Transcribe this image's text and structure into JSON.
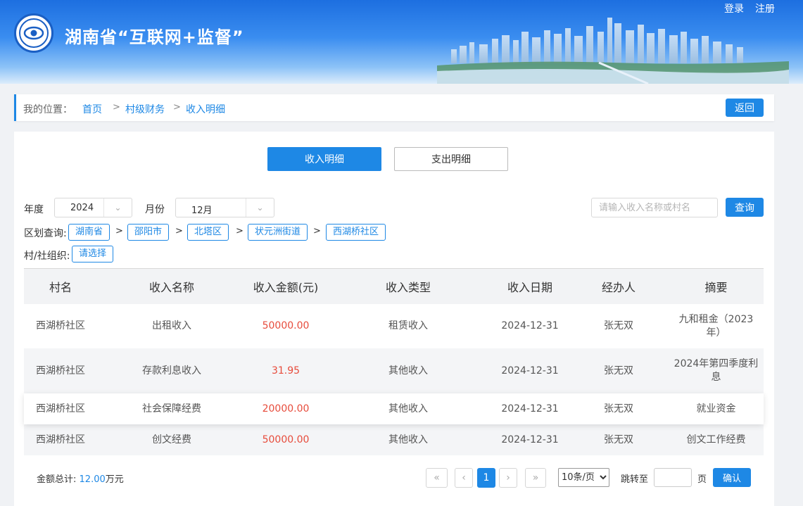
{
  "header": {
    "site_title": "湖南省“互联网+监督”",
    "login": "登录",
    "register": "注册"
  },
  "breadcrumb": {
    "prefix": "我的位置：",
    "items": [
      "首页",
      "村级财务",
      "收入明细"
    ],
    "separator": ">",
    "back": "返回"
  },
  "tabs": [
    "收入明细",
    "支出明细"
  ],
  "filters": {
    "year_label": "年度",
    "year_value": "2024",
    "month_label": "月份",
    "month_value": "12月",
    "search_placeholder": "请输入收入名称或村名",
    "query_button": "查询",
    "region_label": "区划查询:",
    "regions": [
      "湖南省",
      "邵阳市",
      "北塔区",
      "状元洲街道",
      "西湖桥社区"
    ],
    "region_separator": ">",
    "org_label": "村/社组织:",
    "org_value": "请选择"
  },
  "table": {
    "columns": [
      "村名",
      "收入名称",
      "收入金额(元)",
      "收入类型",
      "收入日期",
      "经办人",
      "摘要"
    ],
    "rows": [
      {
        "village": "西湖桥社区",
        "name": "出租收入",
        "amount": "50000.00",
        "type": "租赁收入",
        "date": "2024-12-31",
        "handler": "张无双",
        "summary": "九和租金（2023年）"
      },
      {
        "village": "西湖桥社区",
        "name": "存款利息收入",
        "amount": "31.95",
        "type": "其他收入",
        "date": "2024-12-31",
        "handler": "张无双",
        "summary": "2024年第四季度利息"
      },
      {
        "village": "西湖桥社区",
        "name": "社会保障经费",
        "amount": "20000.00",
        "type": "其他收入",
        "date": "2024-12-31",
        "handler": "张无双",
        "summary": "就业资金"
      },
      {
        "village": "西湖桥社区",
        "name": "创文经费",
        "amount": "50000.00",
        "type": "其他收入",
        "date": "2024-12-31",
        "handler": "张无双",
        "summary": "创文工作经费"
      }
    ]
  },
  "footer": {
    "total_label": "金额总计:",
    "total_value": "12.00",
    "total_unit": "万元",
    "current_page": "1",
    "page_size": "10条/页",
    "jump_label": "跳转至",
    "page_unit": "页",
    "confirm": "确认"
  },
  "colors": {
    "accent": "#1e88e5",
    "amount": "#e74c3c",
    "header_top": "#1d6fe0"
  }
}
